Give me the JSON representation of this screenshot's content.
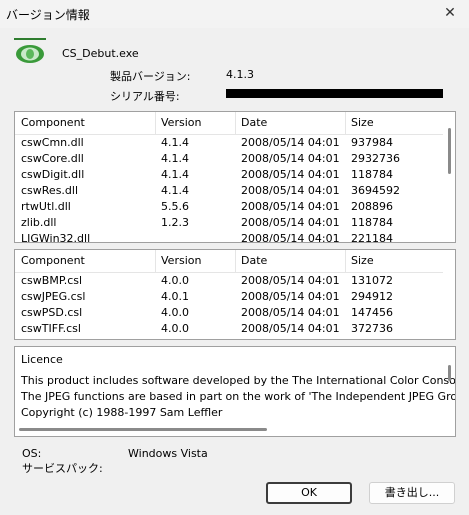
{
  "window": {
    "title": "バージョン情報",
    "close_glyph": "✕"
  },
  "app": {
    "exe_name": "CS_Debut.exe",
    "version_label": "製品バージョン:",
    "version_value": "4.1.3",
    "serial_label": "シリアル番号:"
  },
  "dll_table": {
    "headers": [
      "Component",
      "Version",
      "Date",
      "Size"
    ],
    "rows": [
      [
        "cswCmn.dll",
        "4.1.4",
        "2008/05/14 04:01",
        "937984"
      ],
      [
        "cswCore.dll",
        "4.1.4",
        "2008/05/14 04:01",
        "2932736"
      ],
      [
        "cswDigit.dll",
        "4.1.4",
        "2008/05/14 04:01",
        "118784"
      ],
      [
        "cswRes.dll",
        "4.1.4",
        "2008/05/14 04:01",
        "3694592"
      ],
      [
        "rtwUtl.dll",
        "5.5.6",
        "2008/05/14 04:01",
        "208896"
      ],
      [
        "zlib.dll",
        "1.2.3",
        "2008/05/14 04:01",
        "118784"
      ],
      [
        "LIGWin32.dll",
        "",
        "2008/05/14 04:01",
        "221184"
      ]
    ]
  },
  "csl_table": {
    "headers": [
      "Component",
      "Version",
      "Date",
      "Size"
    ],
    "rows": [
      [
        "cswBMP.csl",
        "4.0.0",
        "2008/05/14 04:01",
        "131072"
      ],
      [
        "cswJPEG.csl",
        "4.0.1",
        "2008/05/14 04:01",
        "294912"
      ],
      [
        "cswPSD.csl",
        "4.0.0",
        "2008/05/14 04:01",
        "147456"
      ],
      [
        "cswTIFF.csl",
        "4.0.0",
        "2008/05/14 04:01",
        "372736"
      ]
    ]
  },
  "licence": {
    "title": "Licence",
    "lines": [
      "This product includes software developed by the The International Color Consorti",
      "The JPEG functions are based in part on the work of 'The Independent JPEG Gro",
      "Copyright (c) 1988-1997 Sam Leffler"
    ]
  },
  "system": {
    "os_label": "OS:",
    "os_value": "Windows Vista",
    "sp_label": "サービスパック:"
  },
  "buttons": {
    "ok": "OK",
    "export": "書き出し..."
  }
}
